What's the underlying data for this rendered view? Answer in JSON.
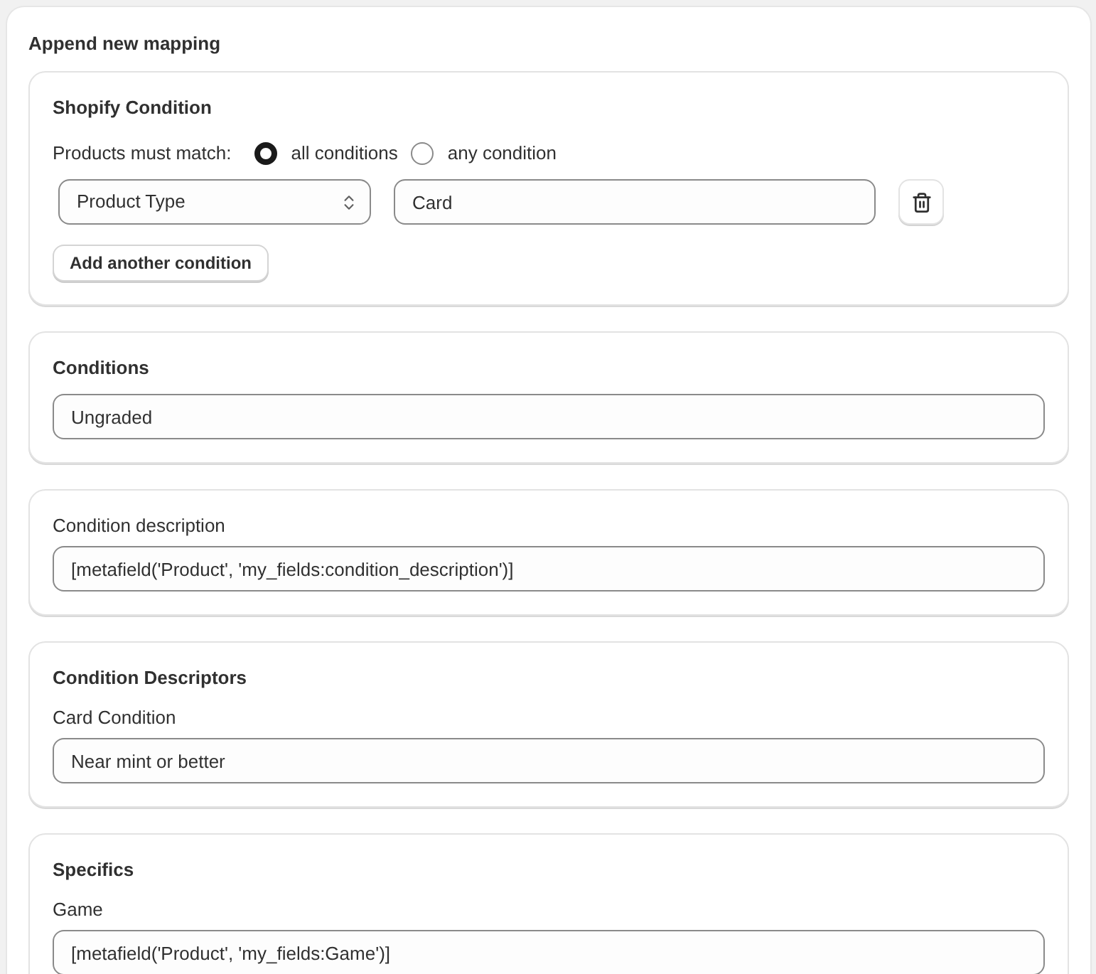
{
  "title": "Append new mapping",
  "sections": [
    {
      "kind": "shopify_condition",
      "title": "Shopify Condition",
      "match": {
        "label": "Products must match:",
        "options": [
          {
            "label": "all conditions",
            "selected": true
          },
          {
            "label": "any condition",
            "selected": false
          }
        ]
      },
      "rows": [
        {
          "field": "Product Type",
          "value": "Card"
        }
      ],
      "add_button": "Add another condition"
    },
    {
      "kind": "fields",
      "title": "Conditions",
      "fields": [
        {
          "value": "Ungraded"
        }
      ]
    },
    {
      "kind": "fields",
      "fields": [
        {
          "label": "Condition description",
          "value": "[metafield('Product', 'my_fields:condition_description')]"
        }
      ]
    },
    {
      "kind": "fields",
      "title": "Condition Descriptors",
      "fields": [
        {
          "label": "Card Condition",
          "value": "Near mint or better"
        }
      ]
    },
    {
      "kind": "fields",
      "title": "Specifics",
      "fields": [
        {
          "label": "Game",
          "value": "[metafield('Product', 'my_fields:Game')]"
        }
      ]
    }
  ]
}
